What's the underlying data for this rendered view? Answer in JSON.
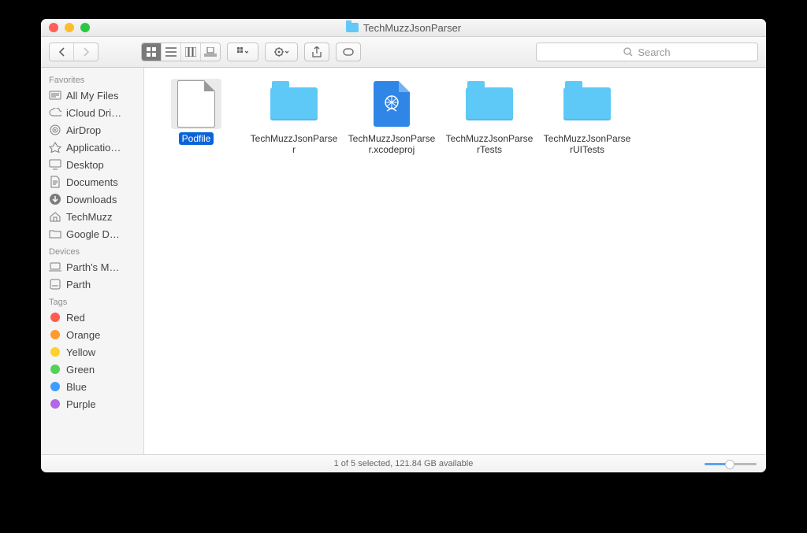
{
  "window": {
    "title": "TechMuzzJsonParser"
  },
  "search": {
    "placeholder": "Search"
  },
  "sidebar": {
    "groups": [
      {
        "label": "Favorites",
        "items": [
          {
            "icon": "all-files",
            "label": "All My Files"
          },
          {
            "icon": "cloud",
            "label": "iCloud Dri…"
          },
          {
            "icon": "airdrop",
            "label": "AirDrop"
          },
          {
            "icon": "apps",
            "label": "Applicatio…"
          },
          {
            "icon": "desktop",
            "label": "Desktop"
          },
          {
            "icon": "docs",
            "label": "Documents"
          },
          {
            "icon": "download",
            "label": "Downloads"
          },
          {
            "icon": "home",
            "label": "TechMuzz"
          },
          {
            "icon": "folder",
            "label": "Google D…"
          }
        ]
      },
      {
        "label": "Devices",
        "items": [
          {
            "icon": "laptop",
            "label": "Parth's M…"
          },
          {
            "icon": "disk",
            "label": "Parth"
          }
        ]
      },
      {
        "label": "Tags",
        "items": [
          {
            "icon": "tag",
            "color": "#ff5b50",
            "label": "Red"
          },
          {
            "icon": "tag",
            "color": "#ff9a2e",
            "label": "Orange"
          },
          {
            "icon": "tag",
            "color": "#ffd02e",
            "label": "Yellow"
          },
          {
            "icon": "tag",
            "color": "#53d258",
            "label": "Green"
          },
          {
            "icon": "tag",
            "color": "#3d9cff",
            "label": "Blue"
          },
          {
            "icon": "tag",
            "color": "#b267e6",
            "label": "Purple"
          }
        ]
      }
    ]
  },
  "items": [
    {
      "type": "file",
      "label": "Podfile",
      "selected": true
    },
    {
      "type": "folder",
      "label": "TechMuzzJsonParser"
    },
    {
      "type": "xproj",
      "label": "TechMuzzJsonParser.xcodeproj"
    },
    {
      "type": "folder",
      "label": "TechMuzzJsonParserTests"
    },
    {
      "type": "folder",
      "label": "TechMuzzJsonParserUITests"
    }
  ],
  "status": "1 of 5 selected, 121.84 GB available"
}
